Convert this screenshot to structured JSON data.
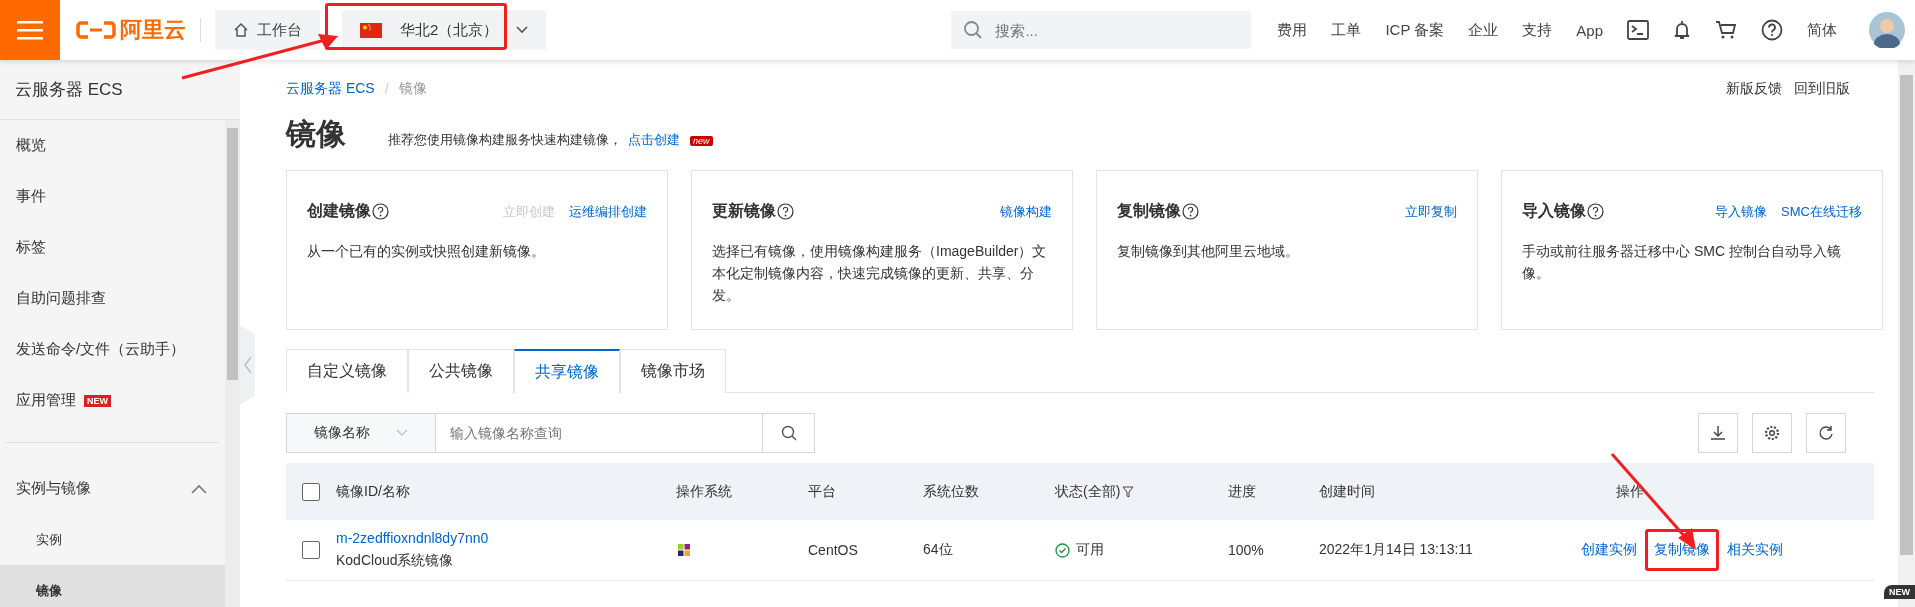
{
  "topbar": {
    "logo": "阿里云",
    "workbench": "工作台",
    "region": "华北2（北京）",
    "search": {
      "placeholder": "搜索..."
    },
    "links": [
      "费用",
      "工单",
      "ICP 备案",
      "企业",
      "支持",
      "App"
    ],
    "language": "简体"
  },
  "sidebar": {
    "title": "云服务器 ECS",
    "items": [
      {
        "label": "概览",
        "selected": false
      },
      {
        "label": "事件",
        "selected": false
      },
      {
        "label": "标签",
        "selected": false
      },
      {
        "label": "自助问题排查",
        "selected": false
      },
      {
        "label": "发送命令/文件（云助手）",
        "selected": false
      },
      {
        "label": "应用管理",
        "badge": "NEW",
        "selected": false
      }
    ],
    "groups": [
      {
        "label": "实例与镜像",
        "expanded": true,
        "children": [
          {
            "label": "实例",
            "selected": false
          },
          {
            "label": "镜像",
            "selected": true
          }
        ]
      }
    ]
  },
  "breadcrumb": [
    "云服务器 ECS",
    "镜像"
  ],
  "breadcrumb_separator": "/",
  "header_links": [
    "新版反馈",
    "回到旧版"
  ],
  "page": {
    "title": "镜像",
    "subtitle": "推荐您使用镜像构建服务快速构建镜像，",
    "link": "点击创建",
    "badge": "new"
  },
  "cards": [
    {
      "title": "创建镜像",
      "actions": [
        {
          "label": "立即创建",
          "disabled": true
        },
        {
          "label": "运维编排创建",
          "disabled": false
        }
      ],
      "text": "从一个已有的实例或快照创建新镜像。"
    },
    {
      "title": "更新镜像",
      "actions": [
        {
          "label": "镜像构建",
          "disabled": false
        }
      ],
      "text": "选择已有镜像，使用镜像构建服务（ImageBuilder）文本化定制镜像内容，快速完成镜像的更新、共享、分发。"
    },
    {
      "title": "复制镜像",
      "actions": [
        {
          "label": "立即复制",
          "disabled": false
        }
      ],
      "text": "复制镜像到其他阿里云地域。"
    },
    {
      "title": "导入镜像",
      "actions": [
        {
          "label": "导入镜像",
          "disabled": false
        },
        {
          "label": "SMC在线迁移",
          "disabled": false
        }
      ],
      "text": "手动或前往服务器迁移中心 SMC 控制台自动导入镜像。"
    }
  ],
  "tabs": [
    {
      "label": "自定义镜像",
      "selected": false
    },
    {
      "label": "公共镜像",
      "selected": false
    },
    {
      "label": "共享镜像",
      "selected": true
    },
    {
      "label": "镜像市场",
      "selected": false
    }
  ],
  "filter": {
    "field": "镜像名称",
    "placeholder": "输入镜像名称查询"
  },
  "table": {
    "header_checked": false,
    "columns": [
      "镜像ID/名称",
      "操作系统",
      "平台",
      "系统位数",
      "状态(全部)",
      "进度",
      "创建时间",
      "操作"
    ],
    "rows": [
      {
        "checked": false,
        "id": "m-2zedffioxndnl8dy7nn0",
        "name": "KodCloud系统镜像",
        "platform": "CentOS",
        "bits": "64位",
        "status": "可用",
        "progress": "100%",
        "created": "2022年1月14日 13:13:11",
        "actions": [
          "创建实例",
          "复制镜像",
          "相关实例"
        ]
      }
    ]
  },
  "corner_badge": "NEW"
}
